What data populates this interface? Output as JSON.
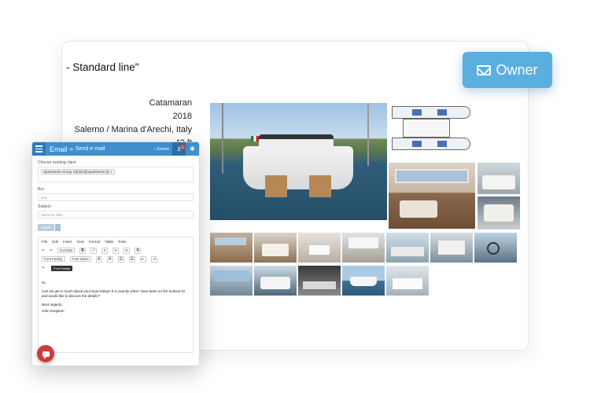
{
  "listing": {
    "title": "- Standard line\"",
    "specs": [
      "Catamaran",
      "2018",
      "Salerno / Marina d'Arechi, Italy",
      "42 ft"
    ]
  },
  "owner_button": {
    "label": "Owner",
    "icon": "envelope-icon",
    "color": "#5aaee0"
  },
  "email": {
    "header": {
      "title": "Email",
      "separator": "»",
      "subtitle": "Send e-mail",
      "events_label": "Events",
      "cart_badge": "1",
      "accent": "#3d8fcf"
    },
    "client_label": "Choose existing client",
    "client_chip": "Spartivento Group Srl(info@spartivento.it)",
    "client_chip_remove": "×",
    "bcc_label": "Bcc",
    "bcc_placeholder": "any",
    "subject_label": "Subject",
    "subject_value": "Yacht for Sale",
    "attach_label": "Attach",
    "attach_arrow": "›",
    "menus": [
      "File",
      "Edit",
      "Insert",
      "View",
      "Format",
      "Table",
      "Tools"
    ],
    "formats_label": "Formats",
    "font_family_label": "Font Family",
    "font_sizes_label": "Font Sizes",
    "tooltip": "Font Family",
    "message": {
      "greeting": "Hi,",
      "body": "Can we get in touch about your boat listing? It is exactly what I have been on the lookout for and would like to discuss the details?",
      "closing": "Best regards,",
      "signature": "John Kingston"
    }
  }
}
